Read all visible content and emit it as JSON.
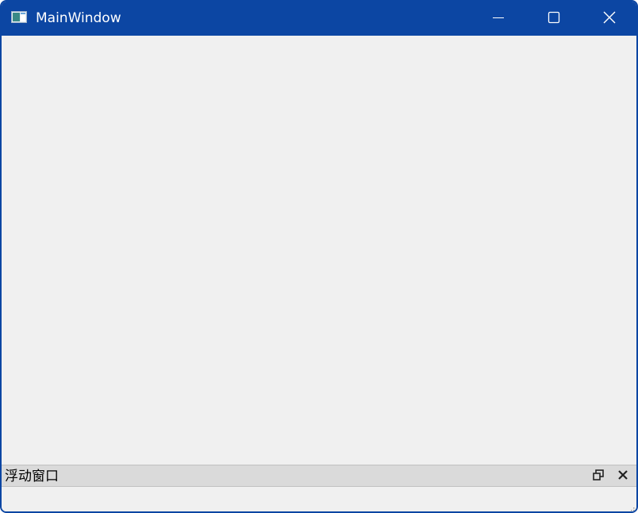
{
  "window": {
    "title": "MainWindow",
    "accent_color": "#0c46a3",
    "icons": {
      "app": "window-app-icon",
      "minimize": "minimize-icon",
      "maximize": "maximize-icon",
      "close": "close-icon"
    }
  },
  "dock": {
    "title": "浮动窗口",
    "icons": {
      "float": "float-restore-icon",
      "close": "close-icon"
    }
  }
}
